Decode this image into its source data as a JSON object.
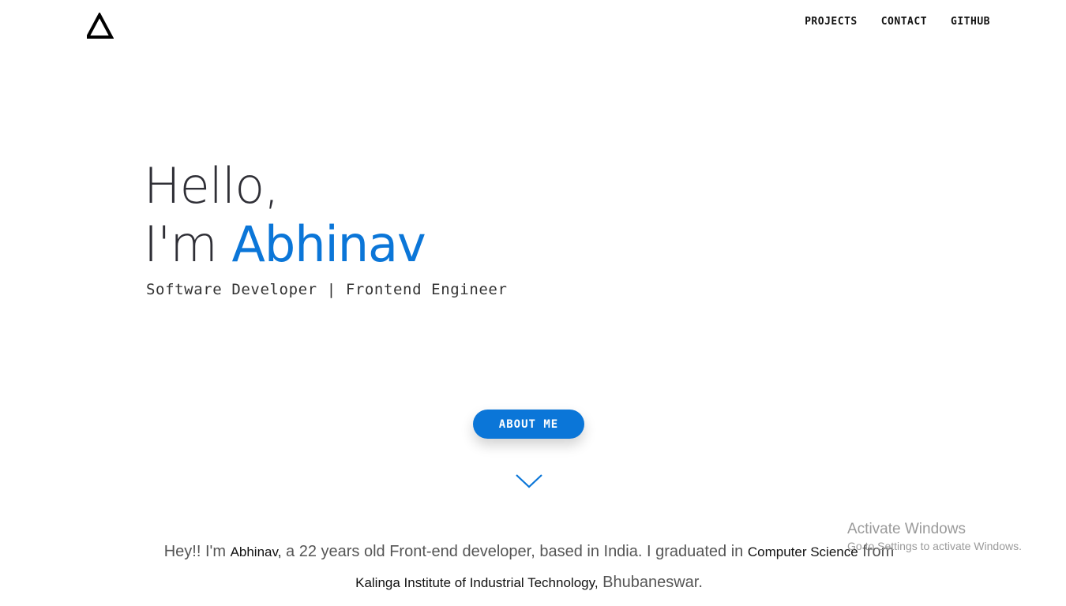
{
  "nav": {
    "items": [
      "PROJECTS",
      "CONTACT",
      "GITHUB"
    ]
  },
  "hero": {
    "greeting": "Hello,",
    "im": "I'm",
    "name": "Abhinav",
    "subtitle": "Software Developer | Frontend Engineer"
  },
  "about_button": {
    "label": "ABOUT ME"
  },
  "intro": {
    "part1": "Hey!! I'm ",
    "name": "Abhinav,",
    "part2": " a 22 years old Front-end developer, based in India. I graduated in ",
    "degree": "Computer Science",
    "part3": " from ",
    "college": "Kalinga Institute of Industrial Technology,",
    "part4": " Bhubaneswar."
  },
  "watermark": {
    "title": "Activate Windows",
    "subtitle": "Go to Settings to activate Windows."
  },
  "colors": {
    "accent": "#0b76d8",
    "text_dark": "#2f2f36",
    "text_muted": "#555555"
  },
  "icons": {
    "logo": "triangle-logo-icon",
    "scroll": "chevron-down-icon"
  }
}
